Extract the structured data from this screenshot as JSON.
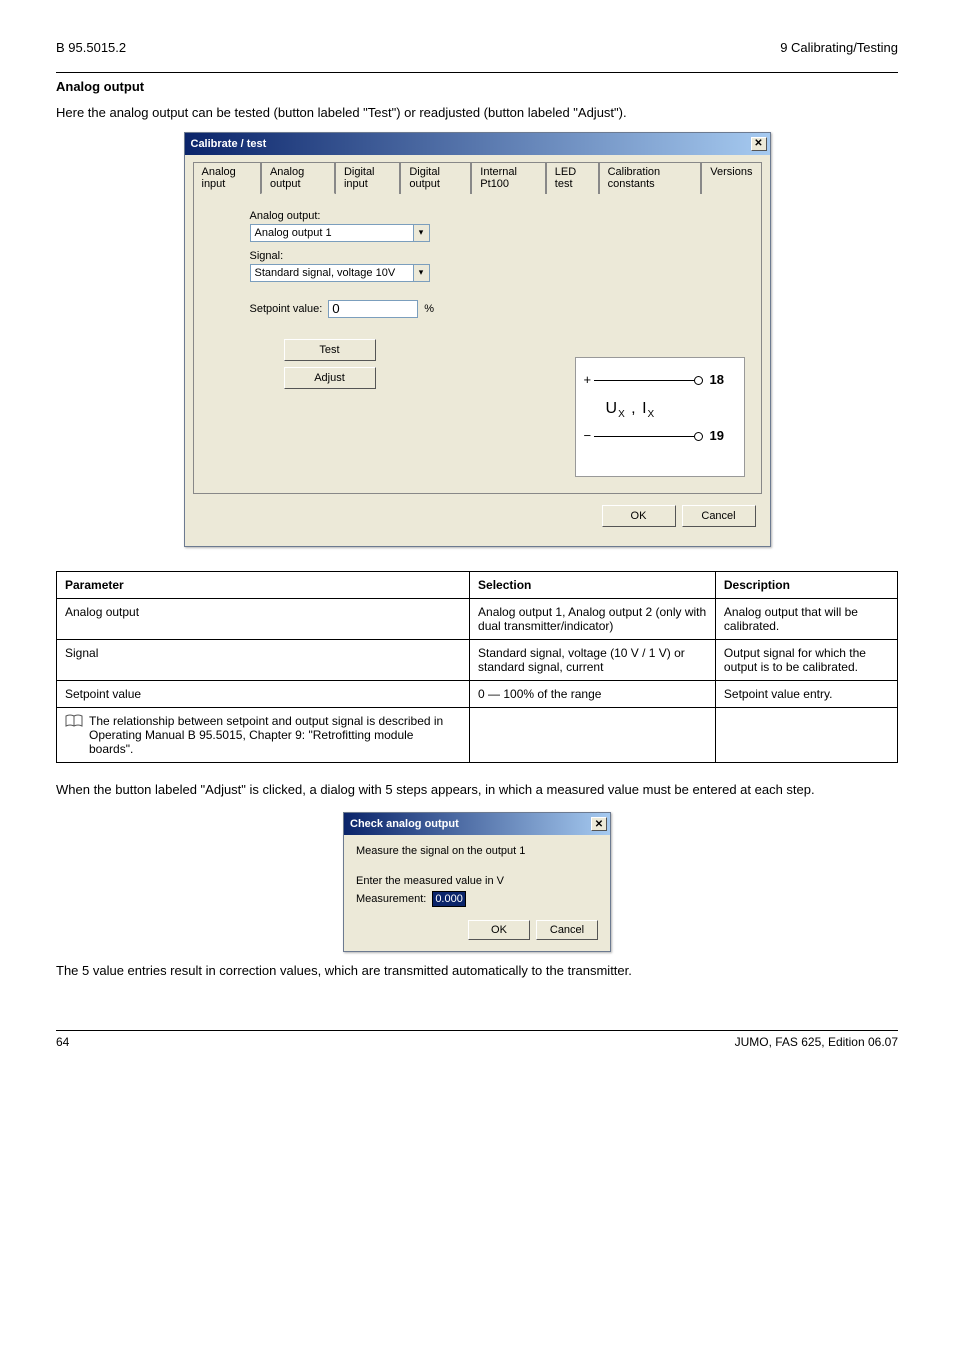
{
  "header": {
    "code": "B 95.5015.2",
    "section": "9 Calibrating/Testing"
  },
  "body": {
    "section_title": "Analog output",
    "intro": "Here the analog output can be tested (button labeled \"Test\") or readjusted (button labeled \"Adjust\").",
    "adjust_intro": "When the button labeled \"Adjust\" is clicked, a dialog with 5 steps appears, in which a measured value must be entered at each step.",
    "closing": "The 5 value entries result in correction values, which are transmitted automatically to the transmitter."
  },
  "dlg1": {
    "title": "Calibrate / test",
    "tabs": [
      "Analog input",
      "Analog output",
      "Digital input",
      "Digital output",
      "Internal Pt100",
      "LED test",
      "Calibration constants",
      "Versions"
    ],
    "form": {
      "analog_output_label": "Analog output:",
      "analog_output_value": "Analog output 1",
      "signal_label": "Signal:",
      "signal_value": "Standard signal, voltage 10V",
      "setpoint_label": "Setpoint value:",
      "setpoint_value": "0",
      "unit": "%",
      "test_btn": "Test",
      "adjust_btn": "Adjust"
    },
    "diagram": {
      "term1": "18",
      "term2": "19"
    },
    "ok": "OK",
    "cancel": "Cancel"
  },
  "table": {
    "head": [
      "Parameter",
      "Selection",
      "Description"
    ],
    "rows": [
      [
        "Analog output",
        "Analog output 1, Analog output 2 (only with dual transmitter/indicator)",
        "Analog output that will be calibrated."
      ],
      [
        "Signal",
        "Standard signal, voltage (10 V / 1 V) or standard signal, current",
        "Output signal for which the output is to be calibrated."
      ],
      [
        "Setpoint value",
        "0 — 100% of the range",
        "Setpoint value entry."
      ],
      [
        "The relationship between setpoint and output signal is described in Operating Manual B 95.5015, Chapter 9: \"Retrofitting module boards\".",
        "",
        ""
      ]
    ]
  },
  "dlg2": {
    "title": "Check analog output",
    "message": "Measure the signal on the output 1",
    "prompt": "Enter the measured value in V",
    "meas_label": "Measurement:",
    "meas_value": "0.000",
    "ok": "OK",
    "cancel": "Cancel"
  },
  "footer": {
    "page": "64",
    "company": "JUMO, FAS 625, Edition 06.07"
  }
}
